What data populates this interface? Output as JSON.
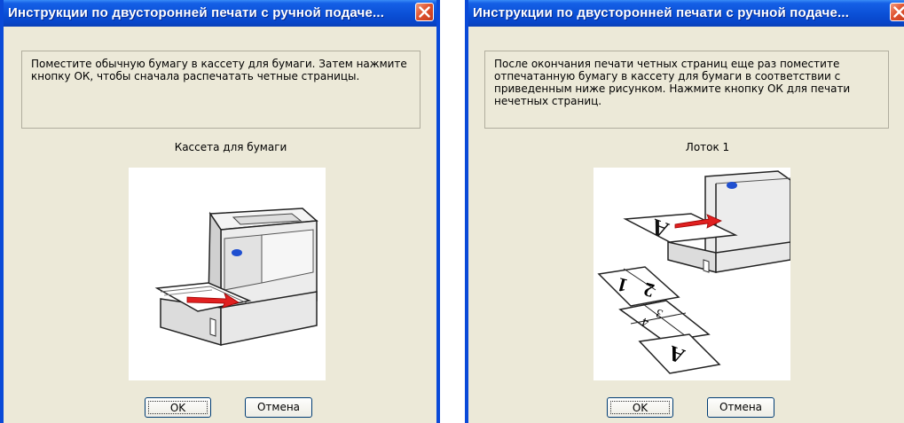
{
  "dialogs": [
    {
      "title": "Инструкции по двусторонней печати с ручной подаче...",
      "message": "Поместите обычную бумагу в кассету для бумаги. Затем нажмите кнопку ОК, чтобы сначала распечатать четные страницы.",
      "caption": "Кассета для бумаги",
      "ok_label": "OK",
      "cancel_label": "Отмена"
    },
    {
      "title": "Инструкции по двусторонней печати с ручной подаче...",
      "message": "После окончания печати четных страниц еще раз поместите отпечатанную бумагу в кассету для бумаги в соответствии с приведенным ниже рисунком. Нажмите кнопку ОК для печати нечетных страниц.",
      "caption": "Лоток 1",
      "ok_label": "OK",
      "cancel_label": "Отмена"
    }
  ],
  "colors": {
    "titlebar": "#0a4fd6",
    "dialog_bg": "#ece9d8",
    "close_button": "#e0532f",
    "arrow": "#e02020",
    "printer_led": "#1f4fd0"
  },
  "illustration_labels": {
    "page_a": "A",
    "page_1": "1",
    "page_2": "2",
    "page_3": "3",
    "page_4": "4"
  }
}
